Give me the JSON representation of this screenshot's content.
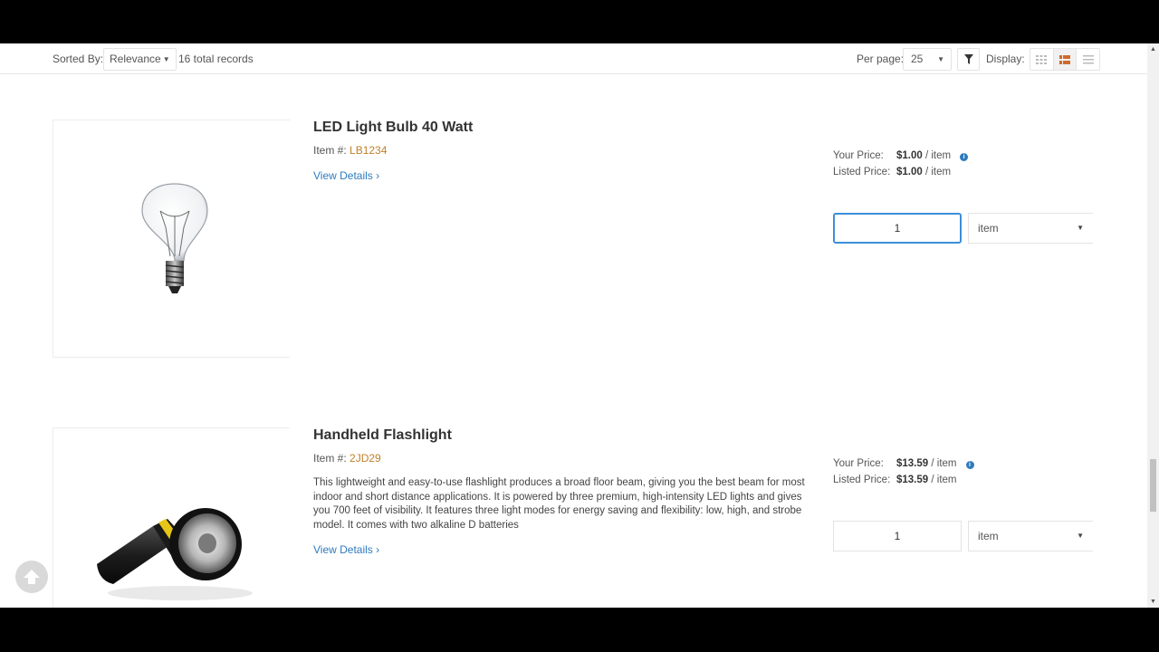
{
  "toolbar": {
    "sorted_label": "Sorted By:",
    "sort_value": "Relevance",
    "records": "16 total records",
    "per_page_label": "Per page:",
    "per_page_value": "25",
    "display_label": "Display:",
    "display_modes": [
      "grid",
      "list-detailed",
      "list-compact"
    ],
    "active_display_mode": "list-detailed"
  },
  "products": [
    {
      "title": "LED Light Bulb 40 Watt",
      "item_label": "Item #:",
      "item_code": "LB1234",
      "description": "",
      "details_link": "View Details ›",
      "your_price_label": "Your Price:",
      "your_price": "$1.00",
      "your_price_unit": " / item",
      "listed_price_label": "Listed Price:",
      "listed_price": "$1.00",
      "listed_price_unit": " / item",
      "qty": "1",
      "unit": "item",
      "image_icon": "light-bulb-image"
    },
    {
      "title": "Handheld Flashlight",
      "item_label": "Item #:",
      "item_code": "2JD29",
      "description": "This lightweight and easy-to-use flashlight produces a broad floor beam, giving you the best beam for most indoor and short distance applications. It is powered by three premium, high-intensity LED lights and gives you 700 feet of visibility. It features three light modes for energy saving and flexibility: low, high, and strobe model. It comes with two alkaline D batteries",
      "details_link": "View Details ›",
      "your_price_label": "Your Price:",
      "your_price": "$13.59",
      "your_price_unit": " / item",
      "listed_price_label": "Listed Price:",
      "listed_price": "$13.59",
      "listed_price_unit": " / item",
      "qty": "1",
      "unit": "item",
      "image_icon": "flashlight-image"
    }
  ],
  "colors": {
    "link": "#2e7bbf",
    "item_code": "#c0812c",
    "focus": "#3d8fd8"
  }
}
